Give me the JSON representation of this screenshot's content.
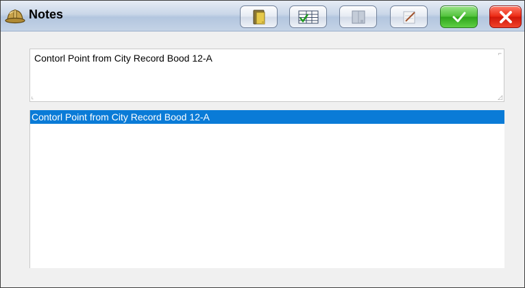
{
  "window": {
    "title": "Notes",
    "title_icon": "hardhat-icon"
  },
  "toolbar": {
    "buttons": [
      {
        "name": "clipboard-button",
        "icon": "clipboard-icon"
      },
      {
        "name": "checklist-button",
        "icon": "checklist-icon"
      },
      {
        "name": "notebook-button",
        "icon": "notebook-icon"
      },
      {
        "name": "pencil-button",
        "icon": "pencil-icon"
      },
      {
        "name": "ok-button",
        "icon": "checkmark-icon",
        "color": "#3cb82a"
      },
      {
        "name": "close-button",
        "icon": "x-icon",
        "color": "#e0210f"
      }
    ]
  },
  "editor": {
    "value": "Contorl Point from City Record Bood 12-A"
  },
  "notes_list": {
    "items": [
      {
        "text": "Contorl Point from City Record Bood 12-A",
        "selected": true
      }
    ],
    "selection_color": "#0a7bd7"
  }
}
